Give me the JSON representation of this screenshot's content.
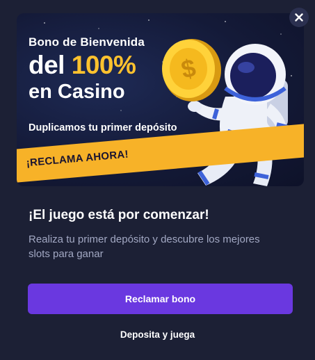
{
  "modal": {
    "close_label": "×",
    "banner": {
      "kicker": "Bono de Bienvenida",
      "line1_prefix": "del ",
      "line1_highlight": "100%",
      "line2": "en Casino",
      "subtitle": "Duplicamos tu primer depósito",
      "ribbon": "¡RECLAMA AHORA!",
      "coin_symbol": "$",
      "illustration": "astronaut-holding-coin"
    },
    "title": "¡El juego está por comenzar!",
    "description": "Realiza tu primer depósito y descubre los mejores slots para ganar",
    "primary_button": "Reclamar bono",
    "secondary_link": "Deposita y juega"
  },
  "colors": {
    "background": "#1c2035",
    "accent": "#6a38e0",
    "highlight": "#ffc22e",
    "ribbon": "#f7b228"
  }
}
